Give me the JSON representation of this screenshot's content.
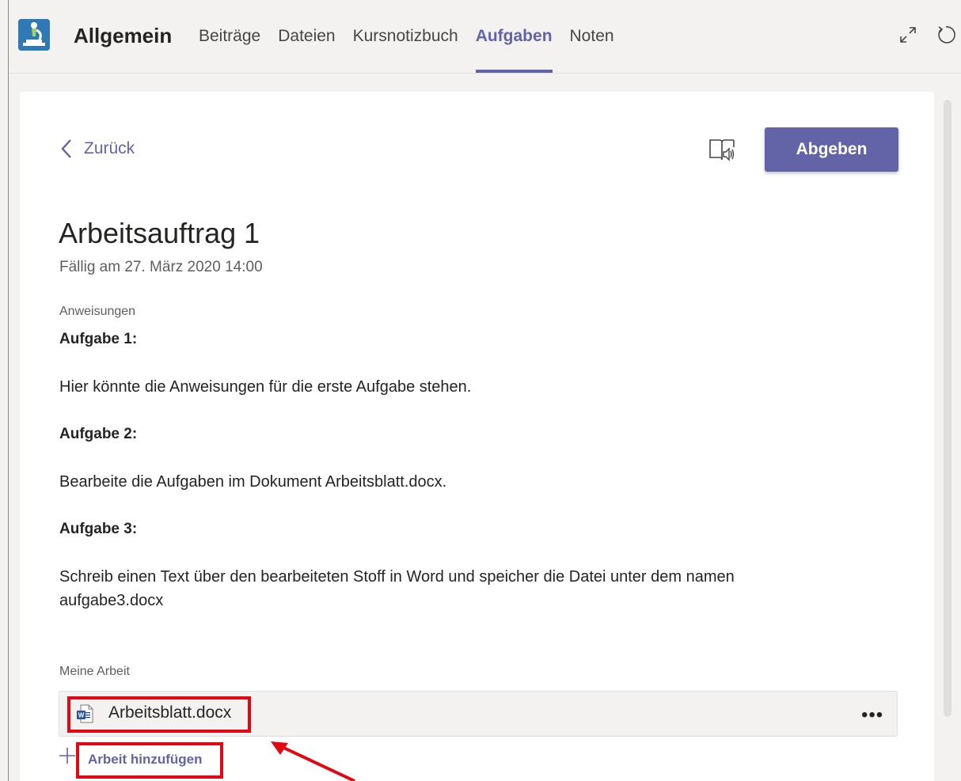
{
  "header": {
    "channel_name": "Allgemein",
    "tabs": [
      {
        "label": "Beiträge",
        "active": false
      },
      {
        "label": "Dateien",
        "active": false
      },
      {
        "label": "Kursnotizbuch",
        "active": false
      },
      {
        "label": "Aufgaben",
        "active": true
      },
      {
        "label": "Noten",
        "active": false
      }
    ],
    "icons": [
      "microscope-app-icon",
      "expand-icon",
      "refresh-icon"
    ]
  },
  "assignment": {
    "back_label": "Zurück",
    "submit_label": "Abgeben",
    "title": "Arbeitsauftrag 1",
    "due": "Fällig am 27. März 2020 14:00",
    "instructions_label": "Anweisungen",
    "task1_heading": "Aufgabe 1:",
    "task1_text": "Hier könnte die Anweisungen für die erste Aufgabe stehen.",
    "task2_heading": "Aufgabe 2:",
    "task2_text": "Bearbeite die Aufgaben im Dokument Arbeitsblatt.docx.",
    "task3_heading": "Aufgabe 3:",
    "task3_text": "Schreib einen Text über den bearbeiteten Stoff in Word und speicher die Datei unter dem namen aufgabe3.docx",
    "my_work_label": "Meine Arbeit",
    "file_name": "Arbeitsblatt.docx",
    "more_label": "•••",
    "add_work_label": "Arbeit hinzufügen"
  },
  "colors": {
    "accent": "#6264a7",
    "highlight": "#e30613",
    "background": "#f3f2f1"
  }
}
